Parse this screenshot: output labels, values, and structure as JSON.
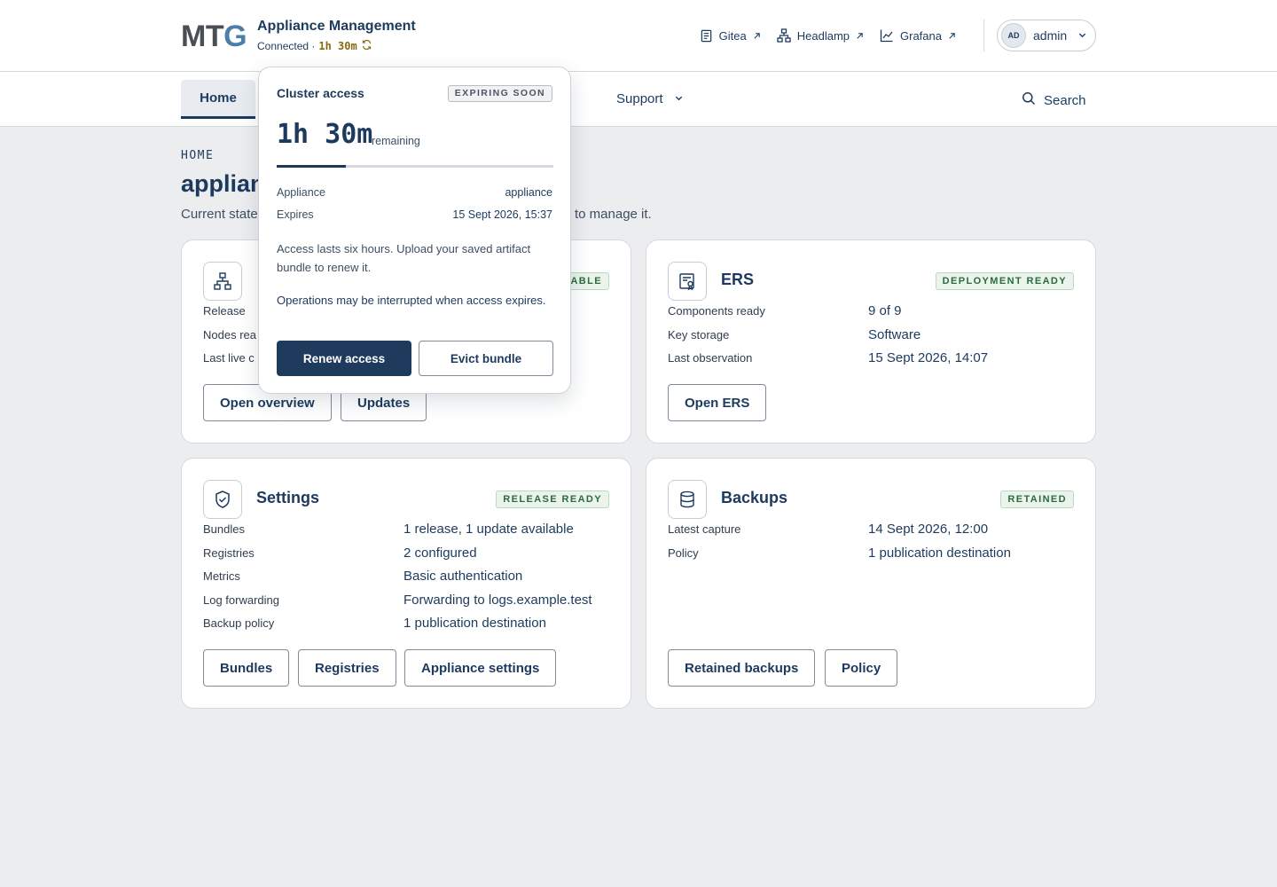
{
  "header": {
    "logo_left": "MT",
    "logo_right": "G",
    "app_title": "Appliance Management",
    "connection_status": "Connected ·",
    "timer": "1h 30m",
    "links": [
      {
        "label": "Gitea",
        "icon": "document-icon"
      },
      {
        "label": "Headlamp",
        "icon": "hierarchy-icon"
      },
      {
        "label": "Grafana",
        "icon": "line-chart-icon"
      }
    ],
    "user": {
      "initials": "AD",
      "name": "admin"
    }
  },
  "nav": {
    "home_label": "Home",
    "support_label": "Support",
    "search_label": "Search"
  },
  "page": {
    "breadcrumb": "HOME",
    "title_visible": "applian",
    "description_left": "Current state",
    "description_right": "to manage it."
  },
  "cards": {
    "appliance": {
      "badge_tail": "ABLE",
      "rows": [
        "Release",
        "Nodes rea",
        "Last live c"
      ],
      "buttons": [
        "Open overview",
        "Updates"
      ]
    },
    "ers": {
      "title": "ERS",
      "badge": "DEPLOYMENT READY",
      "rows": [
        {
          "label": "Components ready",
          "value": "9 of 9"
        },
        {
          "label": "Key storage",
          "value": "Software"
        },
        {
          "label": "Last observation",
          "value": "15 Sept 2026, 14:07"
        }
      ],
      "buttons": [
        "Open ERS"
      ]
    },
    "settings": {
      "title": "Settings",
      "badge": "RELEASE READY",
      "rows": [
        {
          "label": "Bundles",
          "value": "1 release, 1 update available"
        },
        {
          "label": "Registries",
          "value": "2 configured"
        },
        {
          "label": "Metrics",
          "value": "Basic authentication"
        },
        {
          "label": "Log forwarding",
          "value": "Forwarding to logs.example.test"
        },
        {
          "label": "Backup policy",
          "value": "1 publication destination"
        }
      ],
      "buttons": [
        "Bundles",
        "Registries",
        "Appliance settings"
      ]
    },
    "backups": {
      "title": "Backups",
      "badge": "RETAINED",
      "rows": [
        {
          "label": "Latest capture",
          "value": "14 Sept 2026, 12:00"
        },
        {
          "label": "Policy",
          "value": "1 publication destination"
        }
      ],
      "buttons": [
        "Retained backups",
        "Policy"
      ]
    }
  },
  "popover": {
    "title": "Cluster access",
    "badge": "EXPIRING SOON",
    "time": "1h 30m",
    "remaining_label": "remaining",
    "progress_fraction": 0.25,
    "rows": [
      {
        "label": "Appliance",
        "value": "appliance"
      },
      {
        "label": "Expires",
        "value": "15 Sept 2026, 15:37"
      }
    ],
    "note": "Access lasts six hours. Upload your saved artifact bundle to renew it.",
    "warning": "Operations may be interrupted when access expires.",
    "renew_label": "Renew access",
    "evict_label": "Evict bundle"
  },
  "colors": {
    "primary": "#1c3a5e",
    "logo_gray": "#4a4f56",
    "logo_blue": "#4d7ea8",
    "badge_green": "#2c6b3b",
    "timer_amber": "#8a6a10"
  }
}
